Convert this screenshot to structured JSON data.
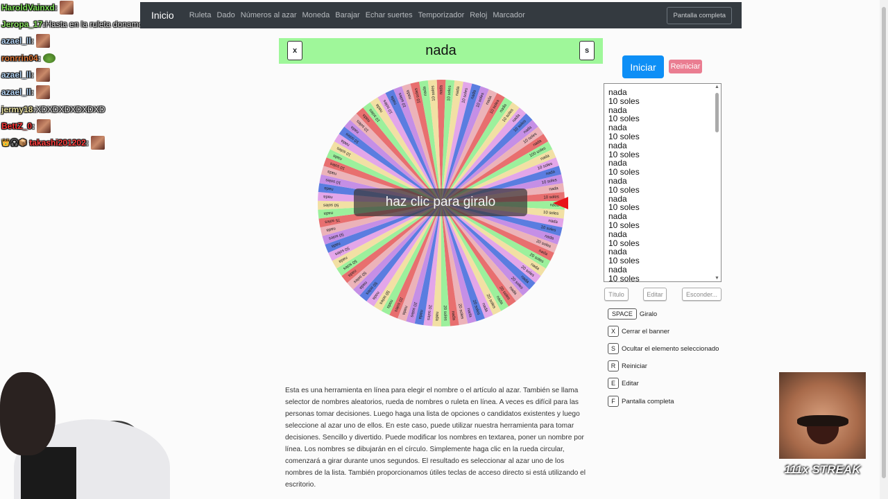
{
  "navbar": {
    "brand": "Inicio",
    "links": [
      "Ruleta",
      "Dado",
      "Números al azar",
      "Moneda",
      "Barajar",
      "Echar suertes",
      "Temporizador",
      "Reloj",
      "Marcador"
    ],
    "fullscreen_label": "Pantalla completa"
  },
  "banner": {
    "title": "nada",
    "close_key": "x",
    "hide_key": "s",
    "color": "#9ff79a"
  },
  "wheel": {
    "center_label": "haz clic para giralo",
    "colors": [
      "#e86f6f",
      "#9cf09c",
      "#f2e0a4",
      "#e3a6e9",
      "#5a7de0",
      "#c58fe6",
      "#ecb3b9"
    ],
    "segments": [
      "nada",
      "10 soles",
      "nada",
      "10 soles",
      "nada",
      "10 soles",
      "nada",
      "10 soles",
      "nada",
      "10 soles",
      "nada",
      "10 soles",
      "nada",
      "10 soles",
      "nada",
      "100 soles",
      "nada",
      "10 soles",
      "nada",
      "10 soles",
      "nada",
      "10 soles",
      "nada",
      "10 soles",
      "nada",
      "10 soles",
      "nada",
      "20 soles",
      "nada",
      "20 soles",
      "nada",
      "20 soles",
      "nada",
      "20 soles",
      "nada",
      "20 soles",
      "nada",
      "20 soles",
      "nada",
      "20 soles",
      "nada",
      "20 soles",
      "nada",
      "20 soles",
      "nada",
      "20 soles",
      "nada",
      "20 soles",
      "nada",
      "20 soles",
      "nada",
      "50 soles",
      "nada",
      "50 soles",
      "nada",
      "50 soles",
      "nada",
      "50 soles",
      "nada",
      "50 soles",
      "nada",
      "50 soles",
      "nada",
      "75 soles",
      "nada",
      "50 soles",
      "nada",
      "nada",
      "10 soles",
      "nada",
      "10 soles",
      "nada",
      "10 soles",
      "nada",
      "10 soles",
      "nada",
      "10 soles",
      "nada",
      "10 soles",
      "nada",
      "10 soles",
      "nada",
      "10 soles",
      "nada",
      "10 soles",
      "nada",
      "10 soles"
    ],
    "pointer_color": "#e8141a"
  },
  "controls": {
    "start_label": "Iniciar",
    "reset_label": "Reiniciar",
    "title_label": "Título",
    "edit_label": "Editar",
    "hide_label": "Esconder..."
  },
  "names": [
    "nada",
    "10 soles",
    "nada",
    "10 soles",
    "nada",
    "10 soles",
    "nada",
    "10 soles",
    "nada",
    "10 soles",
    "nada",
    "10 soles",
    "nada",
    "10 soles",
    "nada",
    "10 soles",
    "nada",
    "10 soles",
    "nada",
    "10 soles",
    "nada",
    "10 soles"
  ],
  "shortcuts": [
    {
      "key": "SPACE",
      "label": "Giralo"
    },
    {
      "key": "X",
      "label": "Cerrar el banner"
    },
    {
      "key": "S",
      "label": "Ocultar el elemento seleccionado"
    },
    {
      "key": "R",
      "label": "Reiniciar"
    },
    {
      "key": "E",
      "label": "Editar"
    },
    {
      "key": "F",
      "label": "Pantalla completa"
    }
  ],
  "description": "Esta es una herramienta en línea para elegir el nombre o el artículo al azar. También se llama selector de nombres aleatorios, rueda de nombres o ruleta en línea. A veces es difícil para las personas tomar decisiones. Luego haga una lista de opciones o candidatos existentes y luego seleccione al azar uno de ellos. En este caso, puede utilizar nuestra herramienta para tomar decisiones. Sencillo y divertido. Puede modificar los nombres en textarea, poner un nombre por línea. Los nombres se dibujarán en el círculo. Simplemente haga clic en la rueda circular, comenzará a girar durante unos segundos. El resultado es seleccionar al azar uno de los nombres de la lista. También proporcionamos útiles teclas de acceso directo si está utilizando el escritorio.",
  "chat": [
    {
      "user": "HaroldVainxd",
      "color": "#7fe05a",
      "msg": "",
      "emote": true
    },
    {
      "user": "Jeropa_17",
      "color": "#8be063",
      "msg": "Hasta en la ruleta donamos",
      "emote": false
    },
    {
      "user": "azael_ll",
      "color": "#b8d8f8",
      "msg": "",
      "emote": true
    },
    {
      "user": "ronrrin04",
      "color": "#e07a3a",
      "msg": "",
      "emote": true,
      "frog": true
    },
    {
      "user": "azael_ll",
      "color": "#b8d8f8",
      "msg": "",
      "emote": true
    },
    {
      "user": "azael_ll",
      "color": "#b8d8f8",
      "msg": "",
      "emote": true
    },
    {
      "user": "jermy18",
      "color": "#e8e0a0",
      "msg": "XDXDXDXDXDXD",
      "emote": false
    },
    {
      "user": "BettZ_0",
      "color": "#ff3a3a",
      "msg": "",
      "emote": true
    },
    {
      "user": "takashi201202",
      "color": "#ff4040",
      "msg": "",
      "emote": true,
      "badges": true
    }
  ],
  "streak": {
    "text": "111x STREAK"
  }
}
